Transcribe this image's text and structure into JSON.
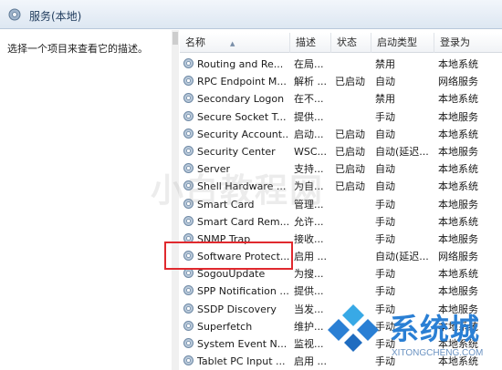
{
  "window": {
    "title": "服务(本地)"
  },
  "left_pane": {
    "description": "选择一个项目来查看它的描述。"
  },
  "columns": {
    "name": "名称",
    "desc": "描述",
    "status": "状态",
    "startup": "启动类型",
    "logon": "登录为"
  },
  "services": [
    {
      "name": "Routing and Re...",
      "desc": "在局...",
      "status": "",
      "startup": "禁用",
      "logon": "本地系统"
    },
    {
      "name": "RPC Endpoint M...",
      "desc": "解析 ...",
      "status": "已启动",
      "startup": "自动",
      "logon": "网络服务"
    },
    {
      "name": "Secondary Logon",
      "desc": "在不...",
      "status": "",
      "startup": "禁用",
      "logon": "本地系统"
    },
    {
      "name": "Secure Socket T...",
      "desc": "提供...",
      "status": "",
      "startup": "手动",
      "logon": "本地服务"
    },
    {
      "name": "Security Account...",
      "desc": "启动...",
      "status": "已启动",
      "startup": "自动",
      "logon": "本地系统"
    },
    {
      "name": "Security Center",
      "desc": "WSC...",
      "status": "已启动",
      "startup": "自动(延迟...",
      "logon": "本地服务"
    },
    {
      "name": "Server",
      "desc": "支持...",
      "status": "已启动",
      "startup": "自动",
      "logon": "本地系统"
    },
    {
      "name": "Shell Hardware ...",
      "desc": "为自...",
      "status": "已启动",
      "startup": "自动",
      "logon": "本地系统"
    },
    {
      "name": "Smart Card",
      "desc": "管理...",
      "status": "",
      "startup": "手动",
      "logon": "本地服务"
    },
    {
      "name": "Smart Card Rem...",
      "desc": "允许...",
      "status": "",
      "startup": "手动",
      "logon": "本地系统"
    },
    {
      "name": "SNMP Trap",
      "desc": "接收...",
      "status": "",
      "startup": "手动",
      "logon": "本地服务"
    },
    {
      "name": "Software Protect...",
      "desc": "启用 ...",
      "status": "",
      "startup": "自动(延迟...",
      "logon": "网络服务"
    },
    {
      "name": "SogouUpdate",
      "desc": "为搜...",
      "status": "",
      "startup": "手动",
      "logon": "本地系统"
    },
    {
      "name": "SPP Notification ...",
      "desc": "提供...",
      "status": "",
      "startup": "手动",
      "logon": "本地服务"
    },
    {
      "name": "SSDP Discovery",
      "desc": "当发...",
      "status": "",
      "startup": "手动",
      "logon": "本地服务"
    },
    {
      "name": "Superfetch",
      "desc": "维护...",
      "status": "",
      "startup": "手动",
      "logon": "本地系统"
    },
    {
      "name": "System Event N...",
      "desc": "监视...",
      "status": "",
      "startup": "手动",
      "logon": "本地系统"
    },
    {
      "name": "Tablet PC Input ...",
      "desc": "启用 ...",
      "status": "",
      "startup": "手动",
      "logon": "本地系统"
    }
  ],
  "watermark": "小白教程网",
  "brand": {
    "name": "系统城",
    "url": "XITONGCHENG.COM"
  },
  "colors": {
    "highlight": "#e0292e",
    "brand": "#2a7fd4",
    "gear": "#6f8aa6"
  },
  "icons": {
    "title": "services-gear-icon",
    "row": "service-gear-icon",
    "brand": "diamond-logo-icon"
  }
}
